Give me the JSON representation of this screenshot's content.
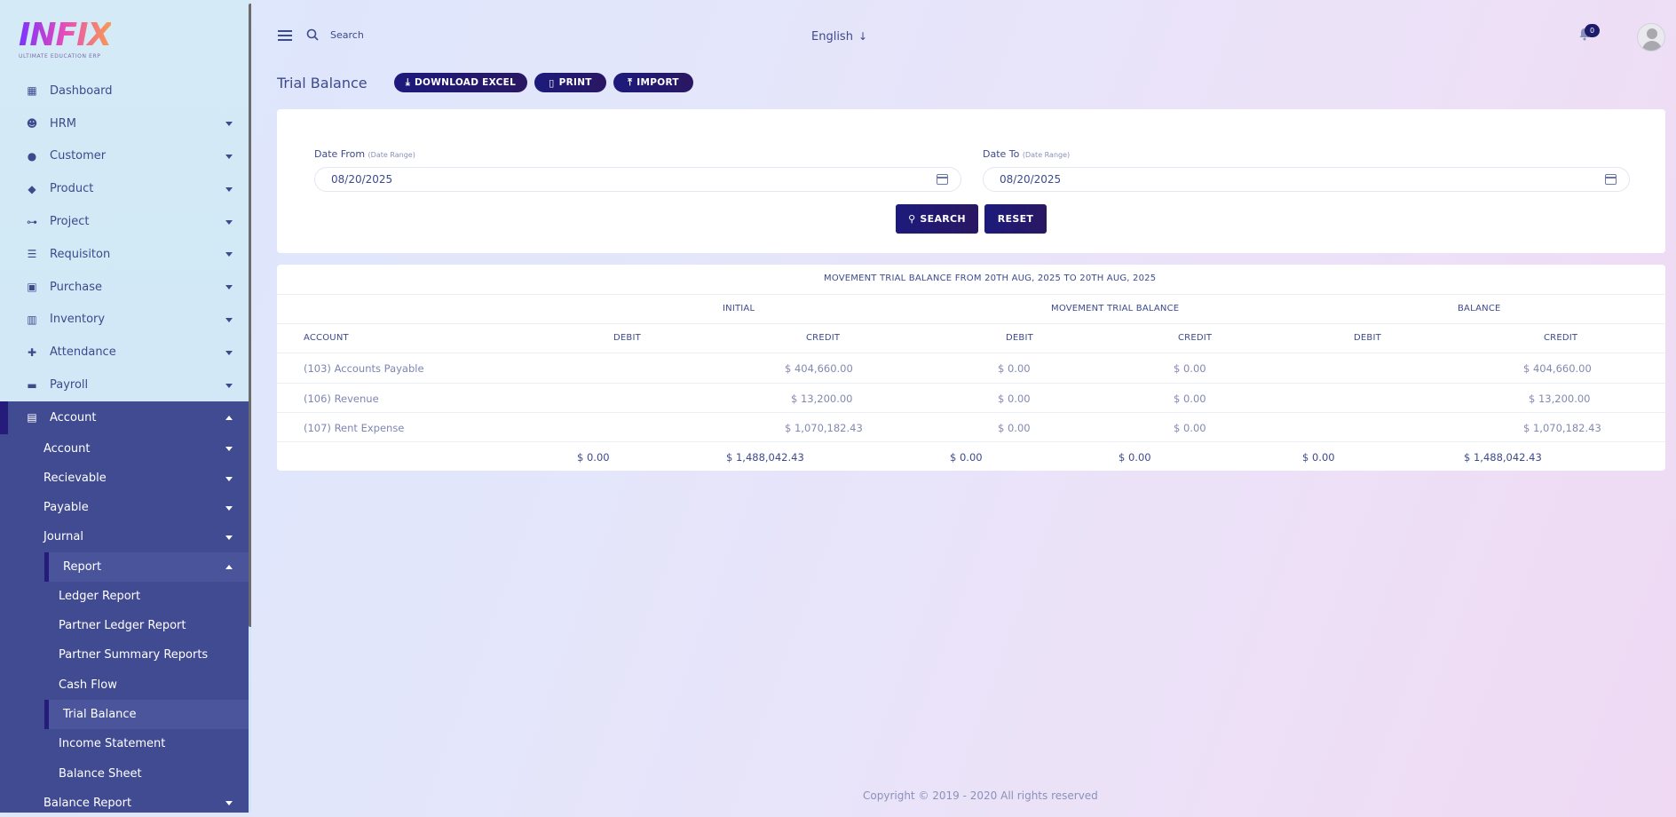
{
  "logo": {
    "word": "INFIX",
    "tagline": "ULTIMATE EDUCATION ERP"
  },
  "sidebar": {
    "items": [
      {
        "label": "Dashboard",
        "icon": "grid-icon"
      },
      {
        "label": "HRM",
        "icon": "users-icon"
      },
      {
        "label": "Customer",
        "icon": "user-icon"
      },
      {
        "label": "Product",
        "icon": "tags-icon"
      },
      {
        "label": "Project",
        "icon": "network-icon"
      },
      {
        "label": "Requisiton",
        "icon": "list-icon"
      },
      {
        "label": "Purchase",
        "icon": "cart-icon"
      },
      {
        "label": "Inventory",
        "icon": "barcode-icon"
      },
      {
        "label": "Attendance",
        "icon": "user-plus-icon"
      },
      {
        "label": "Payroll",
        "icon": "money-icon"
      }
    ],
    "account": {
      "label": "Account",
      "sub": [
        "Account",
        "Recievable",
        "Payable",
        "Journal"
      ],
      "report": "Report",
      "report_items": [
        "Ledger Report",
        "Partner Ledger Report",
        "Partner Summary Reports",
        "Cash Flow",
        "Trial Balance",
        "Income Statement",
        "Balance Sheet"
      ],
      "more": "Balance Report"
    }
  },
  "header": {
    "search_placeholder": "Search",
    "language": "English",
    "notification_count": "0"
  },
  "page": {
    "title": "Trial Balance",
    "buttons": {
      "excel": "DOWNLOAD EXCEL",
      "print": "PRINT",
      "import": "IMPORT"
    }
  },
  "filter": {
    "from_label": "Date From",
    "from_hint": "(Date Range)",
    "from_value": "08/20/2025",
    "to_label": "Date To",
    "to_hint": "(Date Range)",
    "to_value": "08/20/2025",
    "search_label": "SEARCH",
    "reset_label": "RESET"
  },
  "report": {
    "caption": "MOVEMENT TRIAL BALANCE FROM 20TH AUG, 2025 TO 20TH AUG, 2025",
    "groups": [
      "INITIAL",
      "MOVEMENT TRIAL BALANCE",
      "BALANCE"
    ],
    "columns": [
      "ACCOUNT",
      "DEBIT",
      "CREDIT",
      "DEBIT",
      "CREDIT",
      "DEBIT",
      "CREDIT"
    ],
    "rows": [
      [
        "(103) Accounts Payable",
        "",
        "$ 404,660.00",
        "$ 0.00",
        "$ 0.00",
        "",
        "$ 404,660.00"
      ],
      [
        "(106) Revenue",
        "",
        "$ 13,200.00",
        "$ 0.00",
        "$ 0.00",
        "",
        "$ 13,200.00"
      ],
      [
        "(107) Rent Expense",
        "",
        "$ 1,070,182.43",
        "$ 0.00",
        "$ 0.00",
        "",
        "$ 1,070,182.43"
      ]
    ],
    "totals": [
      "$ 0.00",
      "$ 1,488,042.43",
      "$ 0.00",
      "$ 0.00",
      "$ 0.00",
      "$ 1,488,042.43"
    ]
  },
  "footer": {
    "copyright": "Copyright © 2019 - 2020 All rights reserved"
  },
  "colors": {
    "accent": "#1c1a7c",
    "sidebar_active": "#414b91",
    "text": "#415094"
  }
}
